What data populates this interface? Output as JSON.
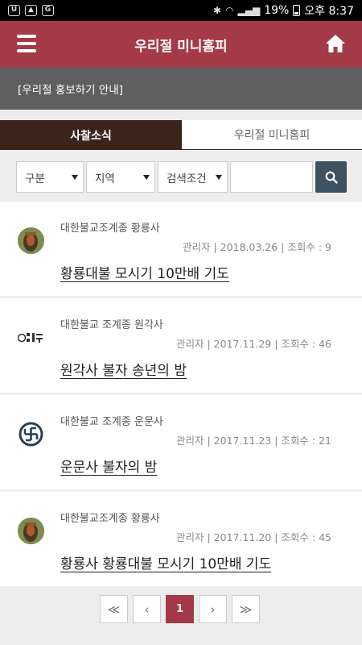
{
  "status_bar": {
    "battery": "19%",
    "time": "오후 8:37",
    "icons": [
      "u-app-icon",
      "gallery-icon",
      "g-app-icon"
    ]
  },
  "header": {
    "title": "우리절 미니홈피",
    "menu_icon": "hamburger-menu-icon",
    "home_icon": "home-icon"
  },
  "promo": {
    "text": "[우리절 홍보하기 안내]"
  },
  "tabs": [
    {
      "label": "사찰소식",
      "active": true
    },
    {
      "label": "우리절 미니홈피",
      "active": false
    }
  ],
  "filters": {
    "category": "구분",
    "region": "지역",
    "search_condition": "검색조건",
    "search_placeholder": ""
  },
  "posts": [
    {
      "temple": "대한불교조계종 황룡사",
      "author": "관리자",
      "date": "2018.03.26",
      "views_label": "조회수 : 9",
      "title": "황룡대불 모시기 10만배 기도",
      "avatar": "buddha-photo"
    },
    {
      "temple": "대한불교 조계종 원각사",
      "author": "관리자",
      "date": "2017.11.29",
      "views_label": "조회수 : 46",
      "title": "원각사 불자 송년의 밤",
      "avatar": "wongaksa-logo"
    },
    {
      "temple": "대한불교 조계종 운문사",
      "author": "관리자",
      "date": "2017.11.23",
      "views_label": "조회수 : 21",
      "title": "운문사 불자의 밤",
      "avatar": "manji-logo"
    },
    {
      "temple": "대한불교조계종 황룡사",
      "author": "관리자",
      "date": "2017.11.20",
      "views_label": "조회수 : 45",
      "title": "황룡사 황룡대불 모시기 10만배 기도",
      "avatar": "buddha-photo"
    }
  ],
  "pagination": {
    "first": "≪",
    "prev": "‹",
    "current": "1",
    "next": "›",
    "last": "≫"
  },
  "colors": {
    "brand": "#a43a47",
    "tab_active": "#3c241c",
    "search_button": "#3d5161",
    "promo_bar": "#5f5f5f"
  }
}
